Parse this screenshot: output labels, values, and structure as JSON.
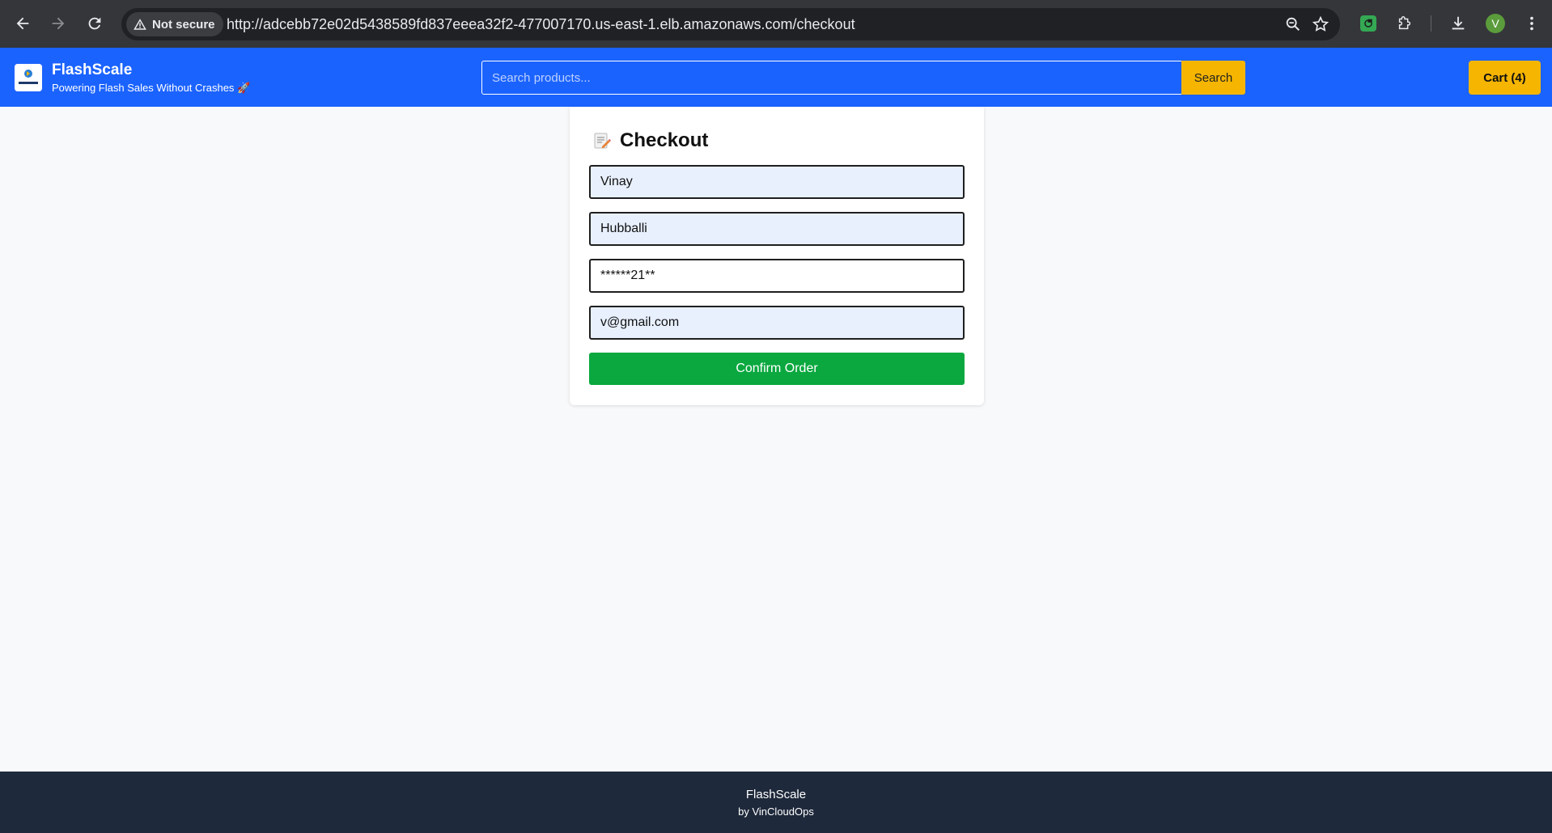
{
  "browser": {
    "security_label": "Not secure",
    "url": "http://adcebb72e02d5438589fd837eeea32f2-477007170.us-east-1.elb.amazonaws.com/checkout",
    "profile_initial": "V"
  },
  "header": {
    "brand_name": "FlashScale",
    "tagline": "Powering Flash Sales Without Crashes 🚀",
    "search_placeholder": "Search products...",
    "search_button": "Search",
    "cart_button": "Cart (4)",
    "accent_color": "#1b63ff",
    "button_color": "#f5b500"
  },
  "checkout": {
    "title": "Checkout",
    "title_icon": "memo-icon",
    "fields": {
      "name": "Vinay",
      "city": "Hubballi",
      "phone": "******21**",
      "email": "v@gmail.com"
    },
    "confirm_button": "Confirm Order",
    "confirm_color": "#0aa83f"
  },
  "footer": {
    "name": "FlashScale",
    "byline": "by VinCloudOps"
  }
}
